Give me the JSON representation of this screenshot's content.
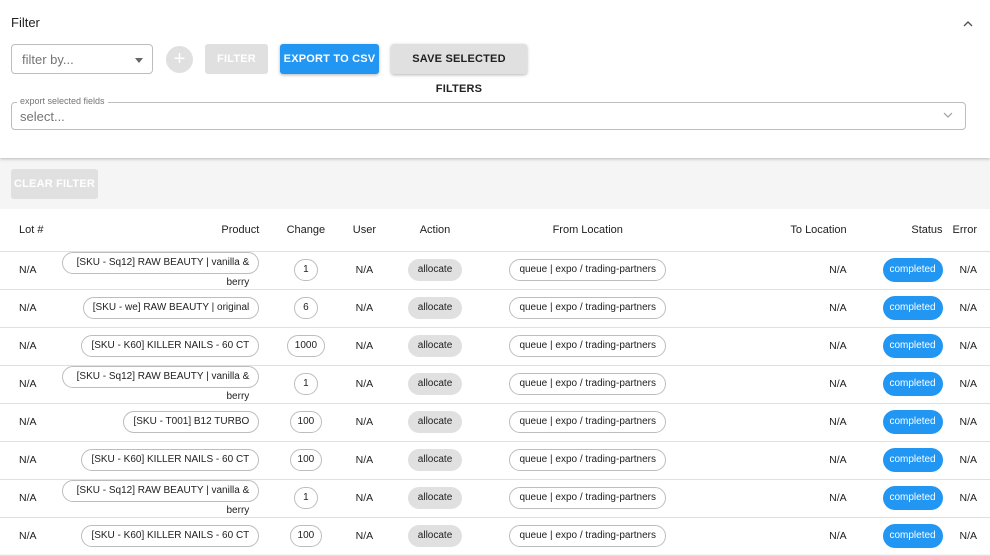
{
  "filter": {
    "title": "Filter",
    "collapse_icon": "chevron-up-icon",
    "filter_by_placeholder": "filter by...",
    "add_label": "+",
    "filter_button": "FILTER",
    "export_button": "EXPORT TO CSV",
    "save_button": "SAVE SELECTED FILTERS",
    "export_fields_label": "export selected fields",
    "export_fields_placeholder": "select...",
    "clear_button": "CLEAR FILTER"
  },
  "colors": {
    "primary": "#2196f3",
    "disabled": "#e0e0e0",
    "background": "#f5f5f5"
  },
  "table": {
    "headers": {
      "lot": "Lot #",
      "product": "Product",
      "change": "Change",
      "user": "User",
      "action": "Action",
      "from": "From Location",
      "to": "To Location",
      "status": "Status",
      "error": "Error"
    },
    "rows": [
      {
        "lot": "N/A",
        "product": "[SKU - Sq12] RAW BEAUTY | vanilla & berry",
        "change": "1",
        "user": "N/A",
        "action": "allocate",
        "from": "queue | expo / trading-partners",
        "to": "N/A",
        "status": "completed",
        "error": "N/A"
      },
      {
        "lot": "N/A",
        "product": "[SKU - we] RAW BEAUTY | original",
        "change": "6",
        "user": "N/A",
        "action": "allocate",
        "from": "queue | expo / trading-partners",
        "to": "N/A",
        "status": "completed",
        "error": "N/A"
      },
      {
        "lot": "N/A",
        "product": "[SKU - K60] KILLER NAILS - 60 CT",
        "change": "1000",
        "user": "N/A",
        "action": "allocate",
        "from": "queue | expo / trading-partners",
        "to": "N/A",
        "status": "completed",
        "error": "N/A"
      },
      {
        "lot": "N/A",
        "product": "[SKU - Sq12] RAW BEAUTY | vanilla & berry",
        "change": "1",
        "user": "N/A",
        "action": "allocate",
        "from": "queue | expo / trading-partners",
        "to": "N/A",
        "status": "completed",
        "error": "N/A"
      },
      {
        "lot": "N/A",
        "product": "[SKU - T001] B12 TURBO",
        "change": "100",
        "user": "N/A",
        "action": "allocate",
        "from": "queue | expo / trading-partners",
        "to": "N/A",
        "status": "completed",
        "error": "N/A"
      },
      {
        "lot": "N/A",
        "product": "[SKU - K60] KILLER NAILS - 60 CT",
        "change": "100",
        "user": "N/A",
        "action": "allocate",
        "from": "queue | expo / trading-partners",
        "to": "N/A",
        "status": "completed",
        "error": "N/A"
      },
      {
        "lot": "N/A",
        "product": "[SKU - Sq12] RAW BEAUTY | vanilla & berry",
        "change": "1",
        "user": "N/A",
        "action": "allocate",
        "from": "queue | expo / trading-partners",
        "to": "N/A",
        "status": "completed",
        "error": "N/A"
      },
      {
        "lot": "N/A",
        "product": "[SKU - K60] KILLER NAILS - 60 CT",
        "change": "100",
        "user": "N/A",
        "action": "allocate",
        "from": "queue | expo / trading-partners",
        "to": "N/A",
        "status": "completed",
        "error": "N/A"
      }
    ]
  }
}
